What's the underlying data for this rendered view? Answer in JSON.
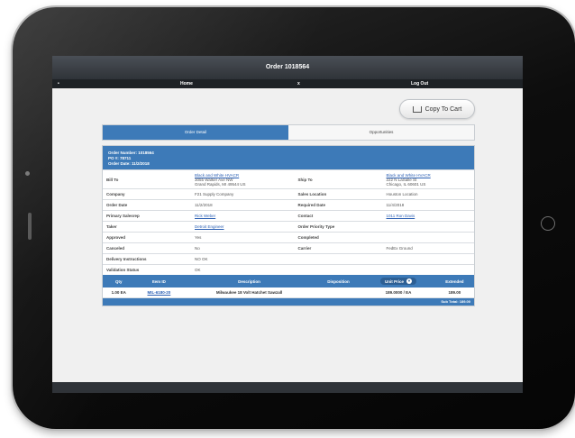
{
  "header": {
    "title": "Order 1018564"
  },
  "nav": {
    "bullet": "•",
    "home": "Home",
    "x": "x",
    "logout": "Log Out"
  },
  "copy_button": {
    "label": "Copy To Cart"
  },
  "tabs": [
    {
      "label": "Order Detail"
    },
    {
      "label": "Opportunities"
    }
  ],
  "summary": {
    "order_number": "Order Number: 1018564",
    "po": "PO #: 78711",
    "order_date": "Order Date: 11/2/2018"
  },
  "details": {
    "bill_to_label": "Bill To",
    "bill_to_name": "Black and White HVACR",
    "bill_to_line1": "3055 Walker Ave NW",
    "bill_to_line2": "Grand Rapids, MI 49544 US",
    "ship_to_label": "Ship To",
    "ship_to_name": "Black and White HVACR",
    "ship_to_line1": "222 N LaSalle St",
    "ship_to_line2": "Chicago, IL 60601 US",
    "rows": [
      {
        "l1": "Company",
        "v1": "F21 Supply Company",
        "l2": "Sales Location",
        "v2": "Houston Location"
      },
      {
        "l1": "Order Date",
        "v1": "11/2/2018",
        "l2": "Required Date",
        "v2": "11/4/2018"
      },
      {
        "l1": "Primary Salesrep",
        "v1": "Rick Weber",
        "l2": "Contact",
        "v2": "1011 Ron Davis"
      },
      {
        "l1": "Taker",
        "v1": "Detroit Engineer",
        "l2": "Order Priority Type",
        "v2": ""
      },
      {
        "l1": "Approved",
        "v1": "Yes",
        "l2": "Completed",
        "v2": ""
      },
      {
        "l1": "Canceled",
        "v1": "No",
        "l2": "Carrier",
        "v2": "FedEx Ground"
      },
      {
        "l1": "Delivery Instructions",
        "v1": "NO OK",
        "l2": "",
        "v2": ""
      },
      {
        "l1": "Validation Status",
        "v1": "OK",
        "l2": "",
        "v2": ""
      }
    ]
  },
  "lines": {
    "headers": {
      "qty": "Qty",
      "item_id": "Item ID",
      "description": "Description",
      "disposition": "Disposition",
      "unit_price": "Unit Price",
      "extended": "Extended"
    },
    "rows": [
      {
        "qty": "1.00 EA",
        "item_id": "MIL-6180-20",
        "description": "Milwaukee 18 Volt Hatchet Sawzall",
        "disposition": "",
        "unit_price": "189.0000 / EA",
        "extended": "189.00"
      }
    ],
    "subtotal": "Sub Total: 189.00"
  }
}
